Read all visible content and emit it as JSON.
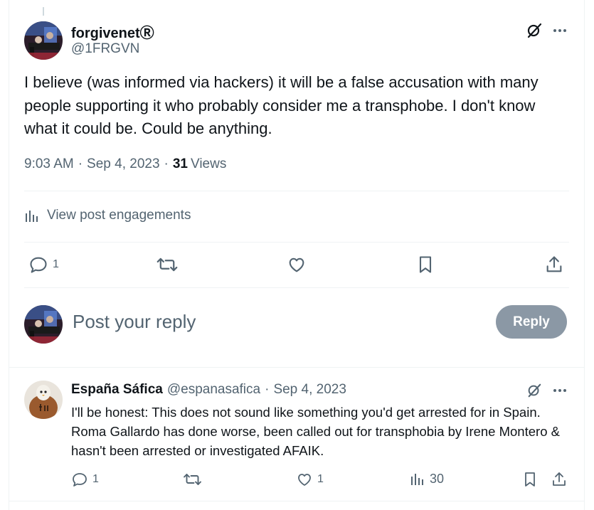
{
  "post": {
    "author_name": "forgivenetⓇ",
    "author_handle": "@1FRGVN",
    "text": "I believe (was informed via hackers) it will be a false accusation with many people supporting it who probably consider me a transphobe. I don't know what it could be. Could be anything.",
    "time": "9:03 AM",
    "date": "Sep 4, 2023",
    "views_count": "31",
    "views_label": "Views",
    "engagements_label": "View post engagements",
    "reply_count": "1"
  },
  "composer": {
    "placeholder": "Post your reply",
    "reply_button": "Reply"
  },
  "reply": {
    "author_name": "España Sáfica",
    "author_handle": "@espanasafica",
    "date": "Sep 4, 2023",
    "text": "I'll be honest: This does not sound like something you'd get arrested for in Spain. Roma Gallardo has done worse, been called out for transphobia by Irene Montero & hasn't been arrested or investigated AFAIK.",
    "reply_count": "1",
    "like_count": "1",
    "views_count": "30"
  },
  "icons": {
    "grok": "grok-icon",
    "more": "more-icon",
    "analytics": "analytics-icon",
    "reply": "reply-icon",
    "repost": "repost-icon",
    "like": "like-icon",
    "bookmark": "bookmark-icon",
    "share": "share-icon"
  },
  "colors": {
    "text": "#0f1419",
    "secondary": "#536471",
    "divider": "#eff3f4",
    "reply_button_disabled": "#8b98a5"
  }
}
